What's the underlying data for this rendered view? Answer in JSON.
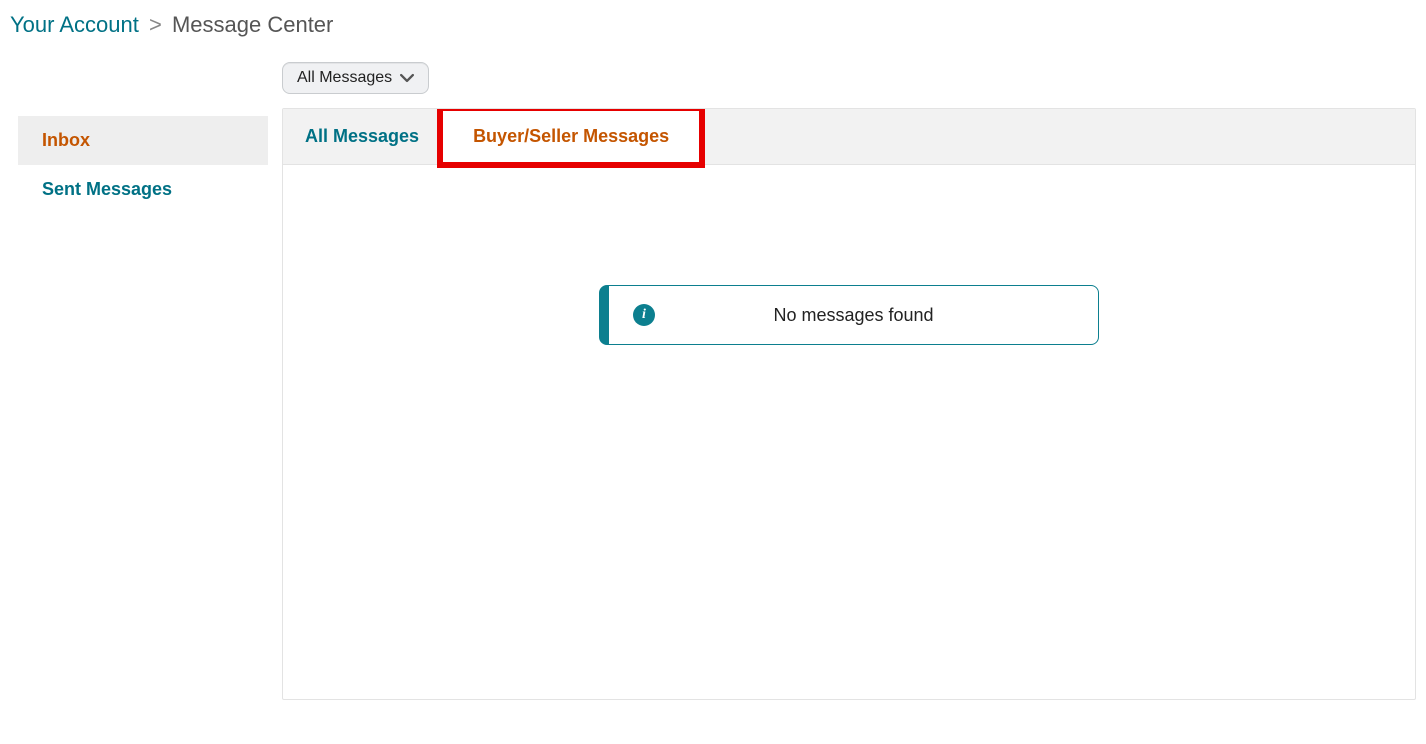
{
  "breadcrumb": {
    "link_label": "Your Account",
    "separator": ">",
    "current": "Message Center"
  },
  "sidebar": {
    "items": [
      {
        "label": "Inbox",
        "active": true
      },
      {
        "label": "Sent Messages",
        "active": false
      }
    ]
  },
  "filter": {
    "label": "All Messages"
  },
  "tabs": {
    "all": "All Messages",
    "buyer_seller": "Buyer/Seller Messages"
  },
  "empty_state": {
    "info_glyph": "i",
    "message": "No messages found"
  }
}
